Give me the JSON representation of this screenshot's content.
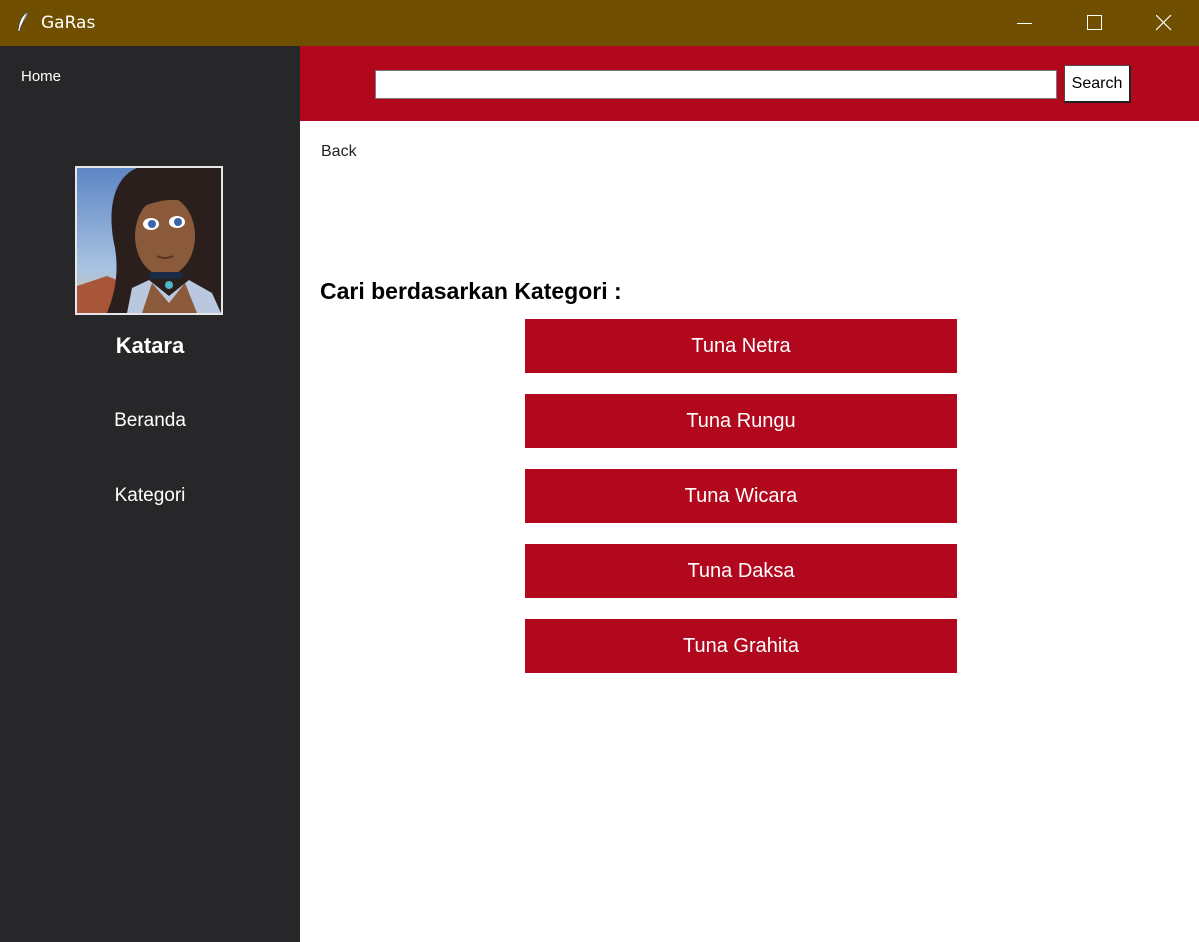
{
  "window": {
    "title": "GaRas",
    "icon": "feather-icon",
    "controls": [
      "minimize-icon",
      "maximize-icon",
      "close-icon"
    ]
  },
  "sidebar": {
    "home_label": "Home",
    "user_name": "Katara",
    "items": [
      {
        "label": "Beranda"
      },
      {
        "label": "Kategori"
      }
    ]
  },
  "search": {
    "value": "",
    "placeholder": "",
    "button_label": "Search"
  },
  "main": {
    "back_label": "Back",
    "heading": "Cari berdasarkan Kategori :",
    "categories": [
      {
        "label": "Tuna Netra"
      },
      {
        "label": "Tuna Rungu"
      },
      {
        "label": "Tuna Wicara"
      },
      {
        "label": "Tuna Daksa"
      },
      {
        "label": "Tuna Grahita"
      }
    ]
  },
  "colors": {
    "titlebar": "#704f00",
    "sidebar": "#272628",
    "accent": "#b2081e",
    "background": "#ffffff"
  }
}
